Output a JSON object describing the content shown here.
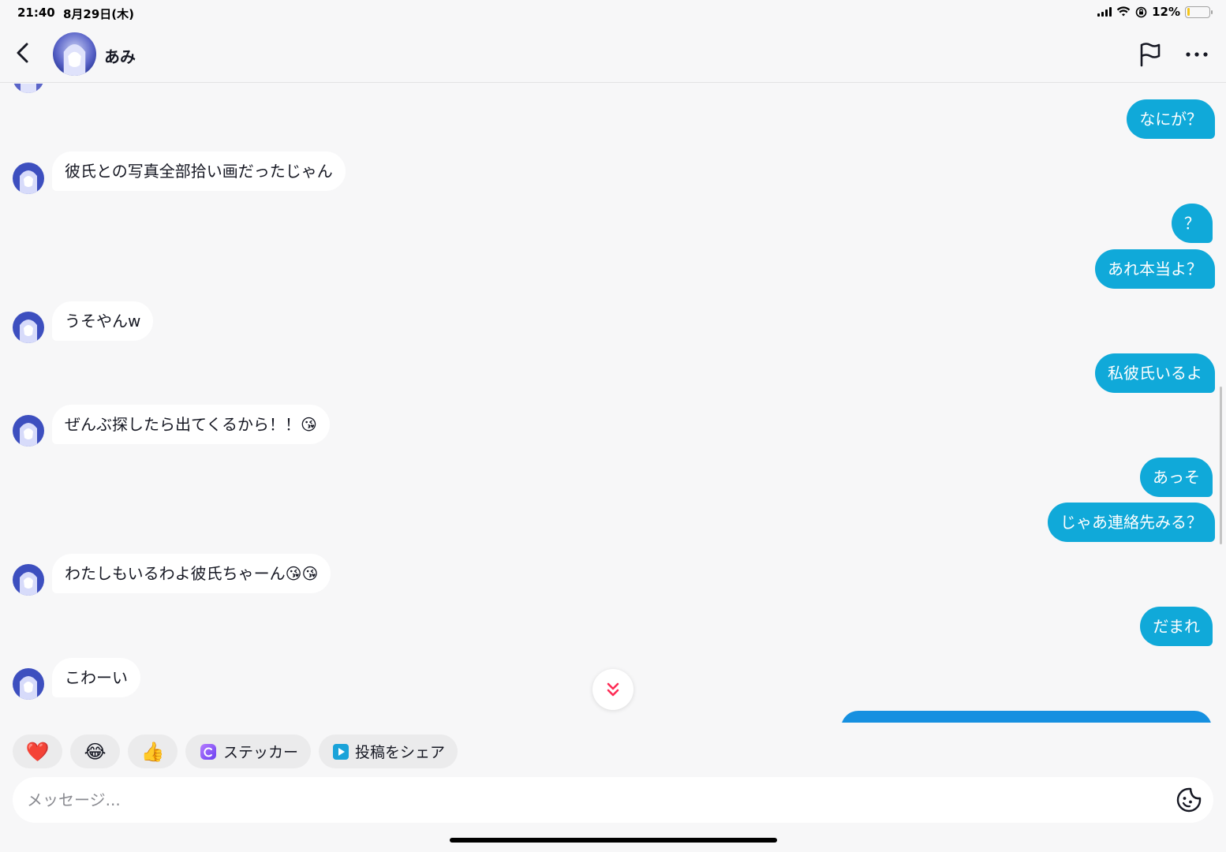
{
  "status_bar": {
    "time": "21:40",
    "date": "8月29日(木)",
    "battery": "12%",
    "battery_level": 0.12
  },
  "header": {
    "contact_name": "あみ"
  },
  "messages_in": [
    {
      "text": "彼氏との写真全部拾い画だったじゃん"
    },
    {
      "text": "うそやんw"
    },
    {
      "text": "ぜんぶ探したら出てくるから！！😘"
    },
    {
      "text": "わたしもいるわよ彼氏ちゃーん😘😘"
    },
    {
      "text": "こわーい"
    }
  ],
  "messages_out": [
    {
      "text": "なにが？"
    },
    {
      "text": "？"
    },
    {
      "text": "あれ本当よ？"
    },
    {
      "text": "私彼氏いるよ"
    },
    {
      "text": "あっそ"
    },
    {
      "text": "じゃあ連絡先みる？"
    },
    {
      "text": "だまれ"
    }
  ],
  "quick_reactions": {
    "heart": "❤️",
    "laugh": "😂",
    "thumbs": "👍",
    "sticker_label": "ステッカー",
    "share_label": "投稿をシェア"
  },
  "composer": {
    "placeholder": "メッセージ..."
  },
  "colors": {
    "outgoing_bubble": "#10a9d9",
    "incoming_bubble": "#ffffff",
    "background": "#f7f7f8",
    "scroll_arrow": "#fe2c55"
  }
}
